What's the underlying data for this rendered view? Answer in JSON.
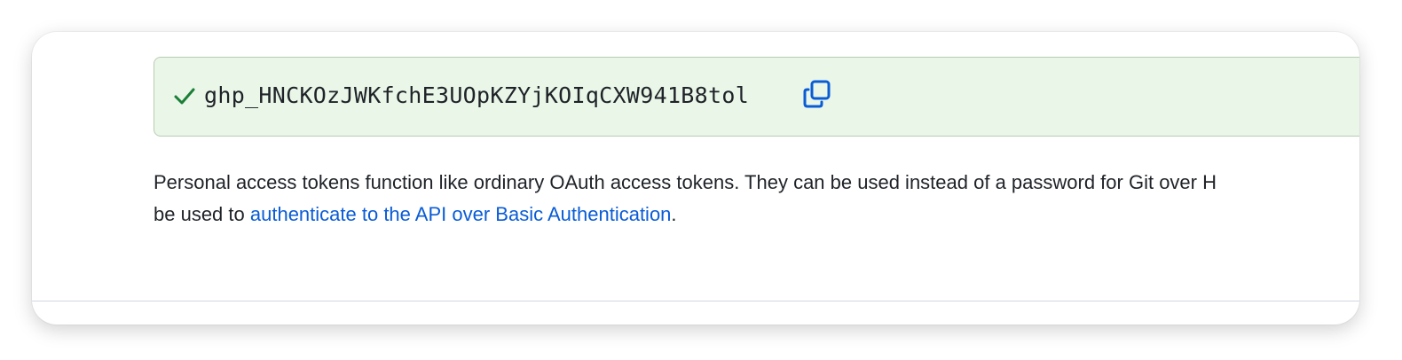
{
  "token": {
    "value": "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",
    "status_icon": "check-icon",
    "copy_icon": "copy-icon"
  },
  "description": {
    "line1": "Personal access tokens function like ordinary OAuth access tokens. They can be used instead of a password for Git over H",
    "line2_prefix": "be used to ",
    "link_text": "authenticate to the API over Basic Authentication",
    "line2_suffix": "."
  },
  "colors": {
    "success_bg": "#eaf6e8",
    "success_border": "#b8cdb2",
    "check_green": "#1a7f37",
    "link_blue": "#0a5cd6",
    "text": "#1f2328"
  }
}
